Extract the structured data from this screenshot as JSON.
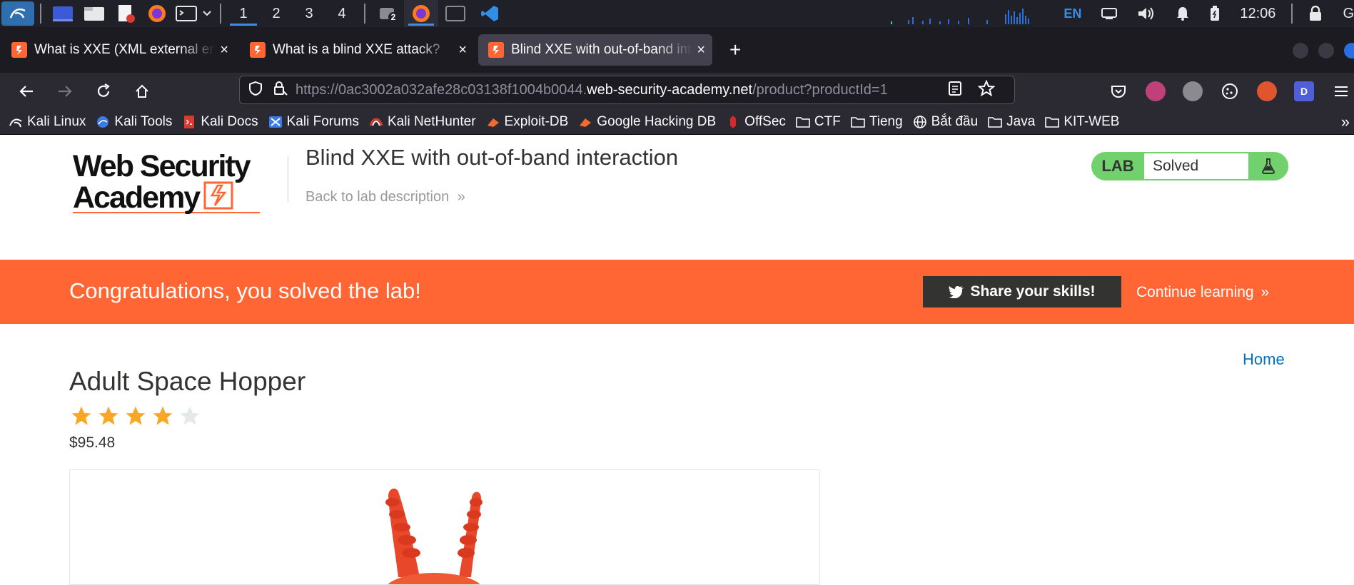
{
  "taskbar": {
    "workspaces": [
      "1",
      "2",
      "3",
      "4"
    ],
    "active_workspace": "1",
    "badge_count": "2",
    "language": "EN",
    "clock": "12:06",
    "trailing_letter": "G"
  },
  "tabs": [
    {
      "title": "What is XXE (XML external entity) injection?",
      "close": "×",
      "active": false
    },
    {
      "title": "What is a blind XXE attack?",
      "close": "×",
      "active": false
    },
    {
      "title": "Blind XXE with out-of-band interaction",
      "close": "×",
      "active": true
    }
  ],
  "new_tab": "+",
  "urlbar": {
    "prefix": "https://0ac3002a032afe28c03138f1004b0044.",
    "host": "web-security-academy.net",
    "path": "/product?productId=1"
  },
  "extensions": [
    {
      "name": "pocket-icon",
      "color": "#2b2a33",
      "label": ""
    },
    {
      "name": "ext-pink-icon",
      "color": "#c0417a",
      "label": ""
    },
    {
      "name": "ext-gray-icon",
      "color": "#8a8a90",
      "label": ""
    },
    {
      "name": "cookie-icon",
      "color": "#2b2a33",
      "label": ""
    },
    {
      "name": "ext-orange-icon",
      "color": "#e0542e",
      "label": ""
    },
    {
      "name": "ext-d-icon",
      "color": "#4e5fd8",
      "label": "D"
    }
  ],
  "bookmarks": [
    {
      "label": "Kali Linux",
      "icon": "kali-icon"
    },
    {
      "label": "Kali Tools",
      "icon": "kali-tools-icon"
    },
    {
      "label": "Kali Docs",
      "icon": "kali-docs-icon"
    },
    {
      "label": "Kali Forums",
      "icon": "kali-forums-icon"
    },
    {
      "label": "Kali NetHunter",
      "icon": "nethunter-icon"
    },
    {
      "label": "Exploit-DB",
      "icon": "exploit-db-icon"
    },
    {
      "label": "Google Hacking DB",
      "icon": "ghdb-icon"
    },
    {
      "label": "OffSec",
      "icon": "offsec-icon"
    },
    {
      "label": "CTF",
      "icon": "folder-icon"
    },
    {
      "label": "Tieng",
      "icon": "folder-icon"
    },
    {
      "label": "Bắt đầu",
      "icon": "globe-icon"
    },
    {
      "label": "Java",
      "icon": "folder-icon"
    },
    {
      "label": "KIT-WEB",
      "icon": "folder-icon"
    }
  ],
  "bookmarks_more": "»",
  "page": {
    "logo_line1": "Web Security",
    "logo_line2": "Academy",
    "lab_title": "Blind XXE with out-of-band interaction",
    "back_link": "Back to lab description",
    "back_chevron": "»",
    "lab_badge_label": "LAB",
    "lab_status": "Solved",
    "banner_text": "Congratulations, you solved the lab!",
    "share_label": "Share your skills!",
    "continue_label": "Continue learning",
    "continue_chevron": "»",
    "home_link": "Home",
    "product_name": "Adult Space Hopper",
    "rating": 4,
    "rating_max": 5,
    "price": "$95.48"
  },
  "colors": {
    "accent": "#ff6633",
    "lab_green": "#70d16d",
    "link_blue": "#0071bc",
    "star_gold": "#f9a825",
    "star_empty": "#e3e8ec"
  }
}
